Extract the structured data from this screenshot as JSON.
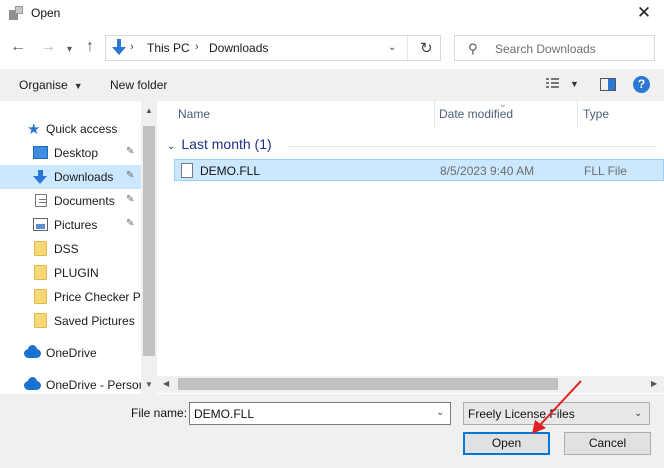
{
  "window": {
    "title": "Open",
    "close_glyph": "✕"
  },
  "nav": {
    "back_glyph": "←",
    "forward_glyph": "→",
    "recent_glyph": "⌄",
    "up_glyph": "↑",
    "refresh_glyph": "↻",
    "address": [
      "This PC",
      "Downloads"
    ],
    "address_sep": "›",
    "search_placeholder": "Search Downloads"
  },
  "toolbar": {
    "organise_label": "Organise",
    "new_folder_label": "New folder",
    "help_glyph": "?"
  },
  "sidebar": {
    "items": [
      {
        "label": "Quick access",
        "icon": "star-icon"
      },
      {
        "label": "Desktop",
        "icon": "desktop-icon",
        "pinned": true
      },
      {
        "label": "Downloads",
        "icon": "downloads-icon",
        "pinned": true,
        "selected": true
      },
      {
        "label": "Documents",
        "icon": "documents-icon",
        "pinned": true
      },
      {
        "label": "Pictures",
        "icon": "pictures-icon",
        "pinned": true
      },
      {
        "label": "DSS",
        "icon": "folder-icon"
      },
      {
        "label": "PLUGIN",
        "icon": "folder-icon"
      },
      {
        "label": "Price Checker Pi",
        "icon": "folder-icon"
      },
      {
        "label": "Saved Pictures",
        "icon": "folder-icon"
      },
      {
        "label": "OneDrive",
        "icon": "onedrive-icon"
      },
      {
        "label": "OneDrive - Persor",
        "icon": "onedrive-icon"
      }
    ],
    "pin_glyph": "📌"
  },
  "columns": {
    "name": "Name",
    "date_modified": "Date modified",
    "type": "Type"
  },
  "group": {
    "label": "Last month (1)"
  },
  "files": [
    {
      "name": "DEMO.FLL",
      "date": "8/5/2023 9:40 AM",
      "type": "FLL File",
      "selected": true
    }
  ],
  "bottom": {
    "file_name_label": "File name:",
    "file_name_value": "DEMO.FLL",
    "file_type_value": "Freely License Files",
    "open_label": "Open",
    "cancel_label": "Cancel"
  },
  "colors": {
    "accent": "#0078d7",
    "selection": "#cce8ff",
    "annotation_arrow": "#e02020"
  }
}
